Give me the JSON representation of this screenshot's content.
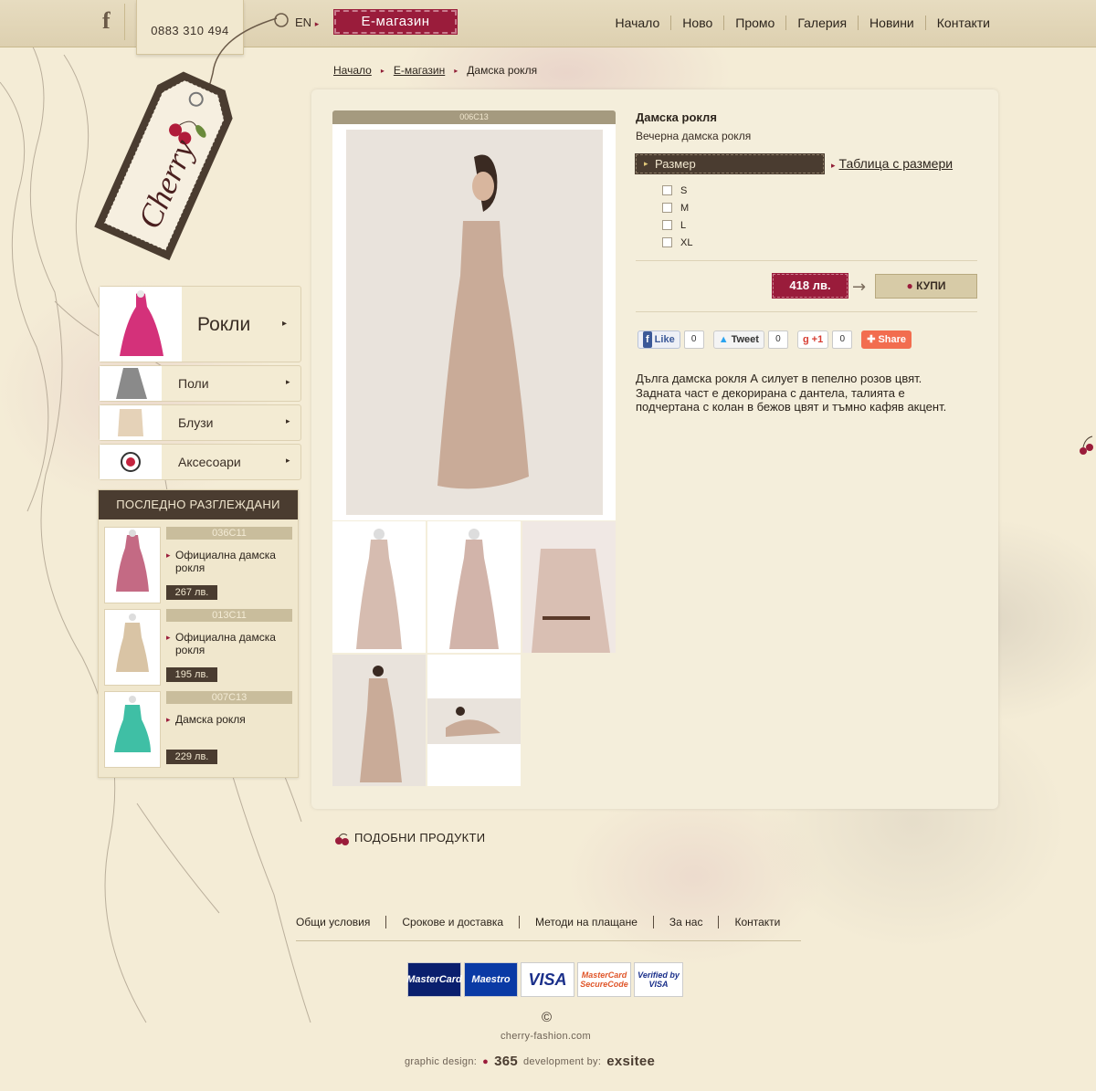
{
  "header": {
    "phone": "0883 310 494",
    "lang": "EN",
    "eshop_label": "E-магазин",
    "nav": [
      "Начало",
      "Ново",
      "Промо",
      "Галерия",
      "Новини",
      "Контакти"
    ]
  },
  "logo": {
    "text": "Cherry"
  },
  "breadcrumb": [
    "Начало",
    "Е-магазин",
    "Дамска рокля"
  ],
  "categories": [
    {
      "label": "Рокли"
    },
    {
      "label": "Поли"
    },
    {
      "label": "Блузи"
    },
    {
      "label": "Аксесоари"
    }
  ],
  "recent": {
    "title": "ПОСЛЕДНО РАЗГЛЕЖДАНИ",
    "items": [
      {
        "code": "036C11",
        "name": "Официална дамска рокля",
        "price": "267 лв."
      },
      {
        "code": "013C11",
        "name": "Официална дамска рокля",
        "price": "195 лв."
      },
      {
        "code": "007C13",
        "name": "Дамска рокля",
        "price": "229 лв."
      }
    ]
  },
  "product": {
    "code": "006C13",
    "title": "Дамска рокля",
    "subtitle": "Вечерна дамска рокля",
    "size_label": "Размер",
    "size_table": "Таблица с размери",
    "sizes": [
      "S",
      "M",
      "L",
      "XL"
    ],
    "price": "418 лв.",
    "buy_label": "КУПИ",
    "description": "Дълга дамска рокля А силует в пепелно розов цвят. Задната част е декорирана с дантела, талията е подчертана с колан в бежов цвят и тъмно кафяв акцент."
  },
  "social": {
    "like": "Like",
    "like_count": "0",
    "tweet": "Tweet",
    "tweet_count": "0",
    "gplus": "+1",
    "gplus_count": "0",
    "share": "Share"
  },
  "similar_title": "ПОДОБНИ ПРОДУКТИ",
  "footer": {
    "links": [
      "Общи условия",
      "Срокове и доставка",
      "Методи на плащане",
      "За нас",
      "Контакти"
    ],
    "cards": [
      "MasterCard",
      "Maestro",
      "VISA",
      "MasterCard SecureCode",
      "Verified by VISA"
    ],
    "copyright": "©",
    "site": "cherry-fashion.com",
    "design_label": "graphic design:",
    "design_by": "365",
    "dev_label": "development by:",
    "dev_by": "exsitee"
  },
  "colors": {
    "accent": "#9a1c3b",
    "dark": "#4a3c30",
    "bg": "#f4ecd6"
  }
}
